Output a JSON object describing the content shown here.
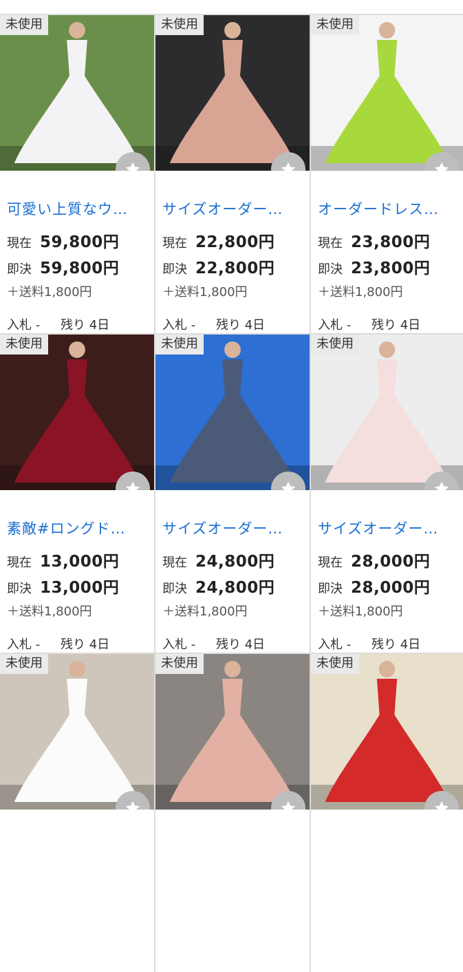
{
  "items": [
    {
      "badge": "未使用",
      "title": "可愛い上質なウ…",
      "current_label": "現在",
      "current": "59,800円",
      "buy_label": "即決",
      "buy": "59,800円",
      "shipping": "＋送料1,800円",
      "bids_label": "入札",
      "bids": "-",
      "remaining_label": "残り",
      "remaining": "4日",
      "bg": "#6a8f4a",
      "dress": "#f3f3f6"
    },
    {
      "badge": "未使用",
      "title": "サイズオーダー…",
      "current_label": "現在",
      "current": "22,800円",
      "buy_label": "即決",
      "buy": "22,800円",
      "shipping": "＋送料1,800円",
      "bids_label": "入札",
      "bids": "-",
      "remaining_label": "残り",
      "remaining": "4日",
      "bg": "#2c2c2e",
      "dress": "#d8a594"
    },
    {
      "badge": "未使用",
      "title": "オーダードレス…",
      "current_label": "現在",
      "current": "23,800円",
      "buy_label": "即決",
      "buy": "23,800円",
      "shipping": "＋送料1,800円",
      "bids_label": "入札",
      "bids": "-",
      "remaining_label": "残り",
      "remaining": "4日",
      "bg": "#f4f4f4",
      "dress": "#a7d83c"
    },
    {
      "badge": "未使用",
      "title": "素敵#ロングド…",
      "current_label": "現在",
      "current": "13,000円",
      "buy_label": "即決",
      "buy": "13,000円",
      "shipping": "＋送料1,800円",
      "bids_label": "入札",
      "bids": "-",
      "remaining_label": "残り",
      "remaining": "4日",
      "bg": "#3c1d1a",
      "dress": "#8a1326"
    },
    {
      "badge": "未使用",
      "title": "サイズオーダー…",
      "current_label": "現在",
      "current": "24,800円",
      "buy_label": "即決",
      "buy": "24,800円",
      "shipping": "＋送料1,800円",
      "bids_label": "入札",
      "bids": "-",
      "remaining_label": "残り",
      "remaining": "4日",
      "bg": "#2d6fd2",
      "dress": "#4a5a78"
    },
    {
      "badge": "未使用",
      "title": "サイズオーダー…",
      "current_label": "現在",
      "current": "28,000円",
      "buy_label": "即決",
      "buy": "28,000円",
      "shipping": "＋送料1,800円",
      "bids_label": "入札",
      "bids": "-",
      "remaining_label": "残り",
      "remaining": "4日",
      "bg": "#ededed",
      "dress": "#f5dede"
    },
    {
      "badge": "未使用",
      "title": "",
      "current_label": "",
      "current": "",
      "buy_label": "",
      "buy": "",
      "shipping": "",
      "bids_label": "",
      "bids": "",
      "remaining_label": "",
      "remaining": "",
      "bg": "#cfc6bb",
      "dress": "#fbfbfb"
    },
    {
      "badge": "未使用",
      "title": "",
      "current_label": "",
      "current": "",
      "buy_label": "",
      "buy": "",
      "shipping": "",
      "bids_label": "",
      "bids": "",
      "remaining_label": "",
      "remaining": "",
      "bg": "#8a8580",
      "dress": "#e3b0a4"
    },
    {
      "badge": "未使用",
      "title": "",
      "current_label": "",
      "current": "",
      "buy_label": "",
      "buy": "",
      "shipping": "",
      "bids_label": "",
      "bids": "",
      "remaining_label": "",
      "remaining": "",
      "bg": "#e9e0cc",
      "dress": "#d42a2a"
    }
  ],
  "icons": {
    "favorite": "star-icon"
  },
  "colors": {
    "title_link": "#1a6fd1",
    "favorite_bg": "#bdbdbd"
  }
}
